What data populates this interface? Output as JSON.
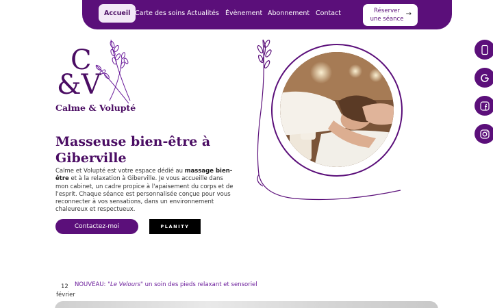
{
  "nav": {
    "items": [
      {
        "label": "Accueil",
        "active": true
      },
      {
        "label": "Carte des soins",
        "active": false
      },
      {
        "label": "Actualités",
        "active": false
      },
      {
        "label": "Évènement",
        "active": false
      },
      {
        "label": "Abonnement",
        "active": false
      },
      {
        "label": "Contact",
        "active": false
      }
    ],
    "cta_line1": "Réserver",
    "cta_line2": "une séance",
    "cta_arrow": "→"
  },
  "social": [
    {
      "icon": "phone-icon"
    },
    {
      "icon": "google-icon"
    },
    {
      "icon": "facebook-icon"
    },
    {
      "icon": "instagram-icon"
    }
  ],
  "logo": {
    "letters_top": "C",
    "letters_bottom": "&V",
    "name": "Calme & Volupté"
  },
  "hero": {
    "headline": "Masseuse bien-être à Giberville",
    "intro_before": "Calme et Volupté est votre espace dédié au ",
    "intro_bold": "massage bien-être",
    "intro_after": " et à la relaxation à Giberville. Je vous accueille dans mon cabinet, un cadre propice à l'apaisement du corps et de l'esprit. Chaque séance est personnalisée conçue pour vous reconnecter à vos sensations, dans un environnement chaleureux et respectueux.",
    "contact_button": "Contactez-moi",
    "planity_button": "PLANITY"
  },
  "news": {
    "day": "12",
    "month": "février",
    "prefix": "NOUVEAU: ",
    "quoted": "\"Le Velours\"",
    "rest": " un soin des pieds relaxant et sensoriel"
  },
  "colors": {
    "brand": "#5b0f7a",
    "brand_dark": "#4a0c63",
    "active_tab_bg": "#f3e8f7",
    "news_text": "#6a1b9a"
  }
}
